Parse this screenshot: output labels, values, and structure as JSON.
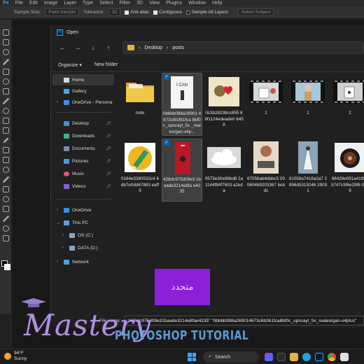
{
  "photoshop": {
    "menu": [
      "Ps",
      "File",
      "Edit",
      "Image",
      "Layer",
      "Type",
      "Select",
      "Filter",
      "3D",
      "View",
      "Plugins",
      "Window",
      "Help"
    ],
    "options": {
      "sample_size": "Sample Size:",
      "sample_value": "Point Sample",
      "tolerance": "Tolerance:",
      "tolerance_value": "32",
      "anti_alias": "Anti-alias",
      "contiguous": "Contiguous",
      "sample_all_layers": "Sample All Layers",
      "select_subject": "Select Subject"
    }
  },
  "dialog": {
    "title": "Open",
    "nav_buttons": [
      "←",
      "→",
      "↓",
      "↑"
    ],
    "breadcrumb": [
      "Desktop",
      "posts"
    ],
    "organize": "Organize ▾",
    "new_folder": "New folder",
    "nav_items": {
      "home": "Home",
      "gallery": "Gallery",
      "onedrive_personal": "OneDrive - Persona",
      "desktop": "Desktop",
      "downloads": "Downloads",
      "documents": "Documents",
      "pictures": "Pictures",
      "music": "Music",
      "videos": "Videos",
      "onedrive": "OneDrive",
      "this_pc": "This PC",
      "os_c": "OS (C:)",
      "data_d": "DATA (D:)",
      "network": "Network"
    },
    "files": [
      {
        "name": "note",
        "kind": "folder"
      },
      {
        "name": "0bbbb088a26901 4673c6b361fca 8bf0c_upscayl_5x _realesrgan-x4p...",
        "kind": "i-can",
        "selected": true
      },
      {
        "name": "0c3b28238cc855 89f1124edeade0 6458",
        "kind": "gear-heart"
      },
      {
        "name": "1",
        "kind": "mug-film"
      },
      {
        "name": "1",
        "kind": "girl-film"
      },
      {
        "name": "2",
        "kind": "mug2-film"
      },
      {
        "name": "0164e3380532c4 6db7e0dd67883 eaff9",
        "kind": "pencil"
      },
      {
        "name": "428dc975d09e3 1baade3214e8fa e4235",
        "kind": "red-book",
        "selected": true
      },
      {
        "name": "9575e30e96bd8 2a1144f84f7603 a2eda",
        "kind": "cloud"
      },
      {
        "name": "67056ab4dbbc5 00060469203367 bebdc",
        "kind": "ladder"
      },
      {
        "name": "81058a7416a2a7 2896d5319246 29031",
        "kind": "person"
      },
      {
        "name": "96428e091a41fb b5747c5f6e29f6 01e9",
        "kind": "coffee"
      }
    ],
    "filename_label": "File name:",
    "filename_value": "\"428dc975d09e31baade3214e8fae4235\" \"0bbbb088a269014673c6b361fca8bf0c_upscayl_5x_realesrgan-x4plus\""
  },
  "overlay": {
    "arabic_button": "متحدد",
    "watermark_script": "Mastery",
    "watermark_sub": "PHOTOSHOP TUTORIAL"
  },
  "taskbar": {
    "temp": "94°F",
    "weather": "Sunny",
    "search": "Search"
  }
}
